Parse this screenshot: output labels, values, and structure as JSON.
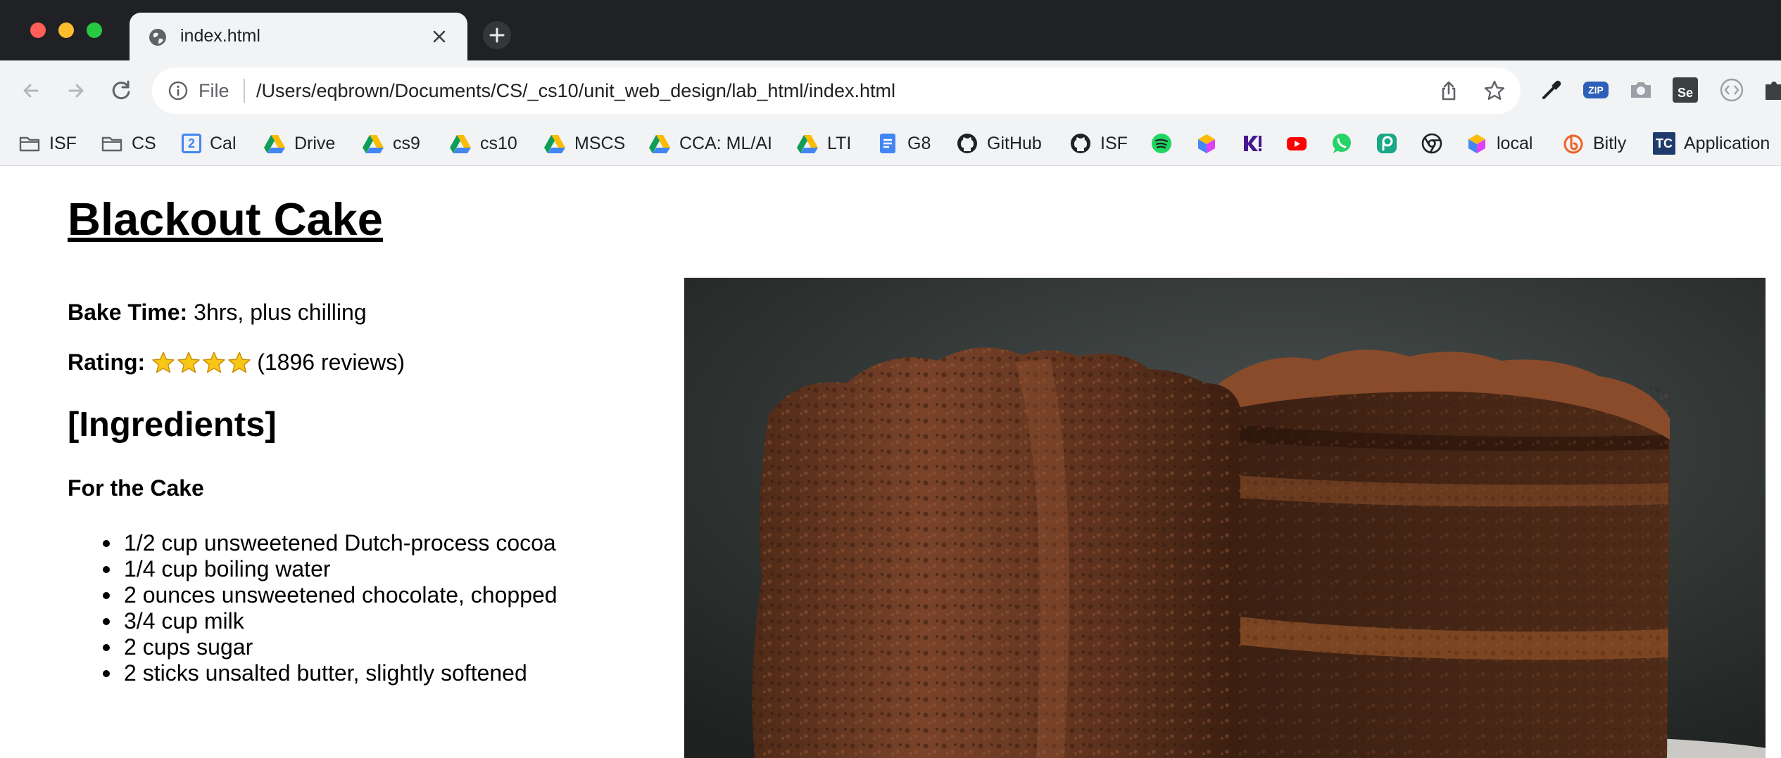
{
  "browser": {
    "tab": {
      "title": "index.html"
    },
    "address_bar": {
      "scheme": "File",
      "url": "/Users/eqbrown/Documents/CS/_cs10/unit_web_design/lab_html/index.html"
    },
    "bookmarks": [
      {
        "label": "ISF",
        "icon": "folder-icon"
      },
      {
        "label": "CS",
        "icon": "folder-icon"
      },
      {
        "label": "Cal",
        "icon": "calendar-icon"
      },
      {
        "label": "Drive",
        "icon": "drive-icon"
      },
      {
        "label": "cs9",
        "icon": "drive-icon"
      },
      {
        "label": "cs10",
        "icon": "drive-icon"
      },
      {
        "label": "MSCS",
        "icon": "drive-icon"
      },
      {
        "label": "CCA: ML/AI",
        "icon": "drive-icon"
      },
      {
        "label": "LTI",
        "icon": "drive-icon"
      },
      {
        "label": "G8",
        "icon": "docs-icon"
      },
      {
        "label": "GitHub",
        "icon": "github-icon"
      },
      {
        "label": "ISF",
        "icon": "github-icon"
      },
      {
        "label": "",
        "icon": "spotify-icon"
      },
      {
        "label": "",
        "icon": "cube-icon"
      },
      {
        "label": "",
        "icon": "kahoot-icon"
      },
      {
        "label": "",
        "icon": "youtube-icon"
      },
      {
        "label": "",
        "icon": "whatsapp-icon"
      },
      {
        "label": "",
        "icon": "p-icon"
      },
      {
        "label": "",
        "icon": "chrome-icon"
      },
      {
        "label": "local",
        "icon": "cube-icon"
      },
      {
        "label": "Bitly",
        "icon": "bitly-icon"
      },
      {
        "label": "Application",
        "icon": "tc-icon",
        "icon_text": "TC"
      }
    ],
    "extensions": {
      "zip_label": "ZIP",
      "se_label": "Se"
    },
    "calendar_icon_text": "2"
  },
  "page": {
    "title": "Blackout Cake",
    "bake_time": {
      "label": "Bake Time:",
      "value": "3hrs, plus chilling"
    },
    "rating": {
      "label": "Rating:",
      "stars": 4,
      "reviews": "(1896 reviews)"
    },
    "ingredients_heading": "[Ingredients]",
    "cake_heading": "For the Cake",
    "ingredients": [
      "1/2 cup unsweetened Dutch-process cocoa",
      "1/4 cup boiling water",
      "2 ounces unsweetened chocolate, chopped",
      "3/4 cup milk",
      "2 cups sugar",
      "2 sticks unsalted butter, slightly softened"
    ]
  },
  "colors": {
    "tabstrip": "#202124",
    "toolbar": "#f1f3f4",
    "cake_dark": "#3b1f12",
    "cake_mid": "#6e3b22",
    "photo_bg": "#2f3433",
    "star": "#f8c614"
  }
}
